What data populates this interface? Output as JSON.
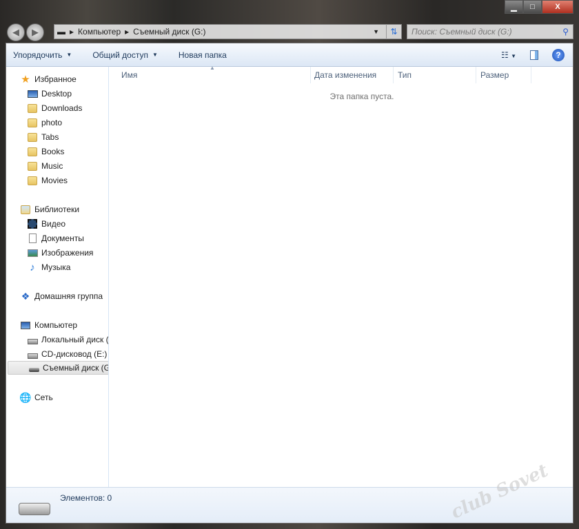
{
  "window": {
    "minimize": "▁",
    "maximize": "□",
    "close": "X"
  },
  "address": {
    "crumbs": [
      "Компьютер",
      "Съемный диск (G:)"
    ]
  },
  "search": {
    "placeholder": "Поиск: Съемный диск (G:)"
  },
  "toolbar": {
    "organize": "Упорядочить",
    "share": "Общий доступ",
    "new_folder": "Новая папка"
  },
  "sidebar": {
    "favorites": {
      "label": "Избранное",
      "items": [
        "Desktop",
        "Downloads",
        "photo",
        "Tabs",
        "Books",
        "Music",
        "Movies"
      ]
    },
    "libraries": {
      "label": "Библиотеки",
      "items": [
        "Видео",
        "Документы",
        "Изображения",
        "Музыка"
      ]
    },
    "homegroup": "Домашняя группа",
    "computer": {
      "label": "Компьютер",
      "items": [
        "Локальный диск (",
        "CD-дисковод (E:)",
        "Съемный диск (G"
      ]
    },
    "network": "Сеть"
  },
  "columns": [
    "Имя",
    "Дата изменения",
    "Тип",
    "Размер"
  ],
  "empty_message": "Эта папка пуста.",
  "status": {
    "items": "Элементов: 0"
  },
  "watermark": "club Sovet"
}
